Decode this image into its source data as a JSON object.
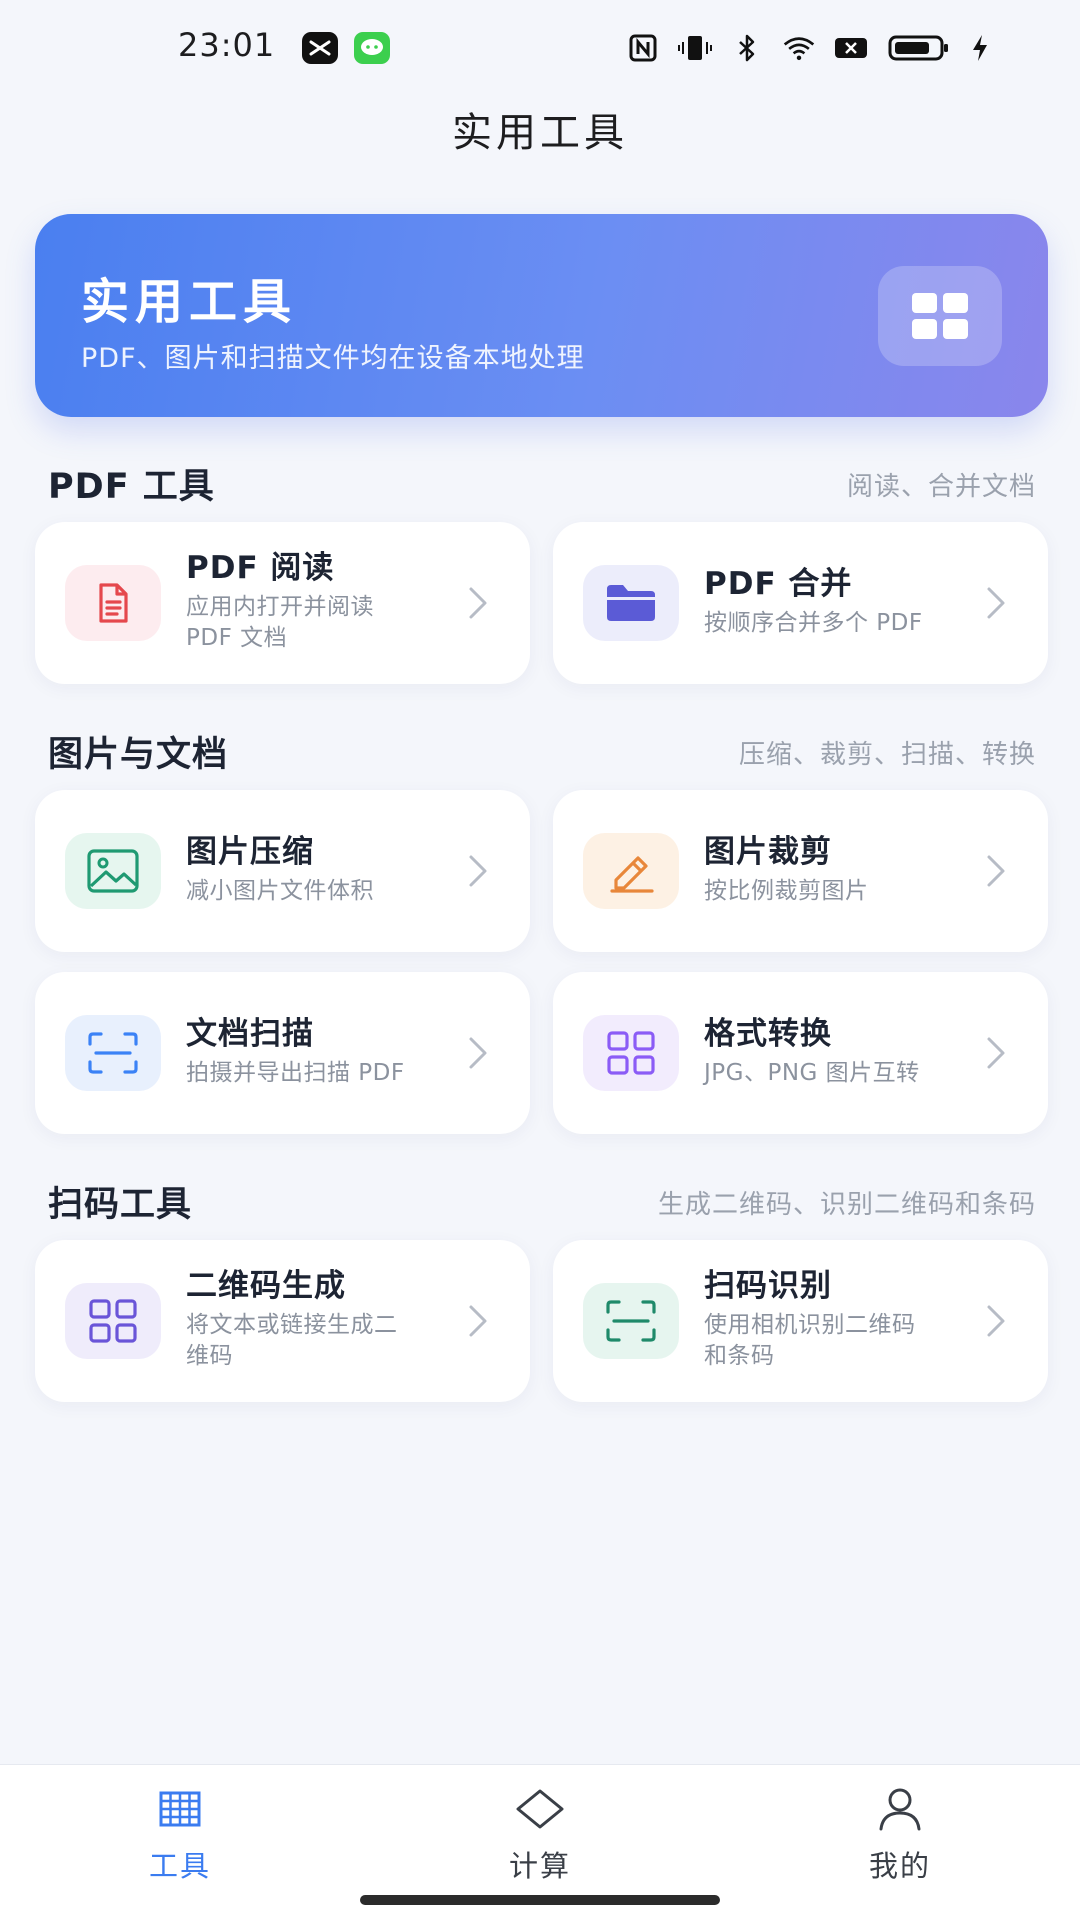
{
  "status_bar": {
    "time": "23:01"
  },
  "header": {
    "title": "实用工具"
  },
  "banner": {
    "title": "实用工具",
    "subtitle": "PDF、图片和扫描文件均在设备本地处理",
    "icon": "grid-icon"
  },
  "sections": [
    {
      "title": "PDF 工具",
      "hint": "阅读、合并文档",
      "cards": [
        {
          "title": "PDF 阅读",
          "desc": "应用内打开并阅读PDF 文档",
          "desc_lines": [
            "应用内打开并阅读",
            "PDF 文档"
          ],
          "icon": "document-icon",
          "icon_color": "#e5484d",
          "icon_bg": "#fdecef"
        },
        {
          "title": "PDF 合并",
          "desc": "按顺序合并多个 PDF",
          "desc_lines": [
            "按顺序合并多个 PDF"
          ],
          "icon": "folder-icon",
          "icon_color": "#5b5bd6",
          "icon_bg": "#ecedfb"
        }
      ]
    },
    {
      "title": "图片与文档",
      "hint": "压缩、裁剪、扫描、转换",
      "cards": [
        {
          "title": "图片压缩",
          "desc_lines": [
            "减小图片文件体积"
          ],
          "icon": "image-icon",
          "icon_color": "#1f9a72",
          "icon_bg": "#e6f6ef"
        },
        {
          "title": "图片裁剪",
          "desc_lines": [
            "按比例裁剪图片"
          ],
          "icon": "pencil-icon",
          "icon_color": "#e8873a",
          "icon_bg": "#fdf1e4"
        },
        {
          "title": "文档扫描",
          "desc_lines": [
            "拍摄并导出扫描 PDF"
          ],
          "icon": "scan-icon",
          "icon_color": "#3b82f6",
          "icon_bg": "#e8f0fd"
        },
        {
          "title": "格式转换",
          "desc_lines": [
            "JPG、PNG 图片互转"
          ],
          "icon": "grid-icon",
          "icon_color": "#8b5cf6",
          "icon_bg": "#f2ecfd"
        }
      ]
    },
    {
      "title": "扫码工具",
      "hint": "生成二维码、识别二维码和条码",
      "cards": [
        {
          "title": "二维码生成",
          "desc_lines": [
            "将文本或链接生成二",
            "维码"
          ],
          "icon": "grid-icon",
          "icon_color": "#6a55d8",
          "icon_bg": "#efecfb"
        },
        {
          "title": "扫码识别",
          "desc_lines": [
            "使用相机识别二维码",
            "和条码"
          ],
          "icon": "scan-icon",
          "icon_color": "#1f8a6a",
          "icon_bg": "#e6f5ef"
        }
      ]
    }
  ],
  "bottom_nav": {
    "items": [
      {
        "label": "工具",
        "icon": "tools-grid-icon",
        "active": true
      },
      {
        "label": "计算",
        "icon": "diamond-icon",
        "active": false
      },
      {
        "label": "我的",
        "icon": "user-icon",
        "active": false
      }
    ],
    "active_color": "#3b7cf0",
    "inactive_color": "#3a3f47"
  }
}
